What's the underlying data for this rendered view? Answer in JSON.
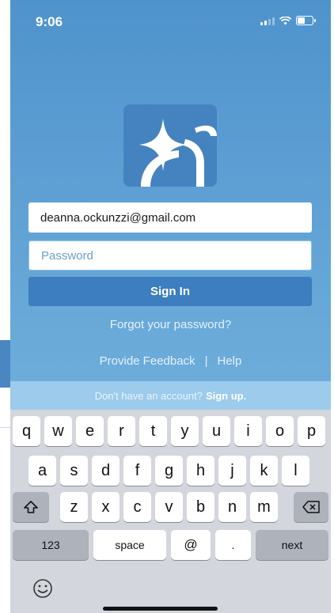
{
  "status_bar": {
    "time": "9:06"
  },
  "login": {
    "email_value": "deanna.ockunzzi@gmail.com",
    "password_placeholder": "Password",
    "sign_in_label": "Sign In",
    "forgot_label": "Forgot your password?",
    "feedback_label": "Provide Feedback",
    "separator": "|",
    "help_label": "Help",
    "signup_prompt": "Don't have an account?",
    "signup_link": "Sign up."
  },
  "keyboard": {
    "row1": [
      "q",
      "w",
      "e",
      "r",
      "t",
      "y",
      "u",
      "i",
      "o",
      "p"
    ],
    "row2": [
      "a",
      "s",
      "d",
      "f",
      "g",
      "h",
      "j",
      "k",
      "l"
    ],
    "row3": [
      "z",
      "x",
      "c",
      "v",
      "b",
      "n",
      "m"
    ],
    "numbers_label": "123",
    "space_label": "space",
    "at_label": "@",
    "period_label": ".",
    "next_label": "next",
    "shift_icon": "shift-icon",
    "backspace_icon": "backspace-icon",
    "emoji_icon": "emoji-icon"
  },
  "colors": {
    "background_top": "#4f93cd",
    "button": "#3c7ebf",
    "logo_tile": "#4583c0",
    "signup_bar": "#9ccbeb"
  }
}
